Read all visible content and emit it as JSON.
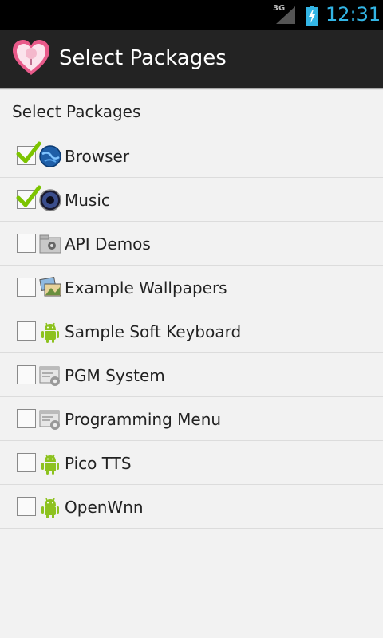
{
  "status_bar": {
    "network_label": "3G",
    "time": "12:31"
  },
  "action_bar": {
    "title": "Select Packages"
  },
  "section_header": "Select Packages",
  "packages": [
    {
      "label": "Browser",
      "checked": true,
      "icon": "globe-icon"
    },
    {
      "label": "Music",
      "checked": true,
      "icon": "speaker-icon"
    },
    {
      "label": "API Demos",
      "checked": false,
      "icon": "folder-gear-icon"
    },
    {
      "label": "Example Wallpapers",
      "checked": false,
      "icon": "pictures-icon"
    },
    {
      "label": "Sample Soft Keyboard",
      "checked": false,
      "icon": "android-icon"
    },
    {
      "label": "PGM System",
      "checked": false,
      "icon": "settings-window-icon"
    },
    {
      "label": "Programming Menu",
      "checked": false,
      "icon": "settings-window-icon"
    },
    {
      "label": "Pico TTS",
      "checked": false,
      "icon": "android-icon"
    },
    {
      "label": "OpenWnn",
      "checked": false,
      "icon": "android-icon"
    }
  ],
  "colors": {
    "clock": "#33b5e5",
    "action_bar": "#232323",
    "check": "#7cc400"
  }
}
